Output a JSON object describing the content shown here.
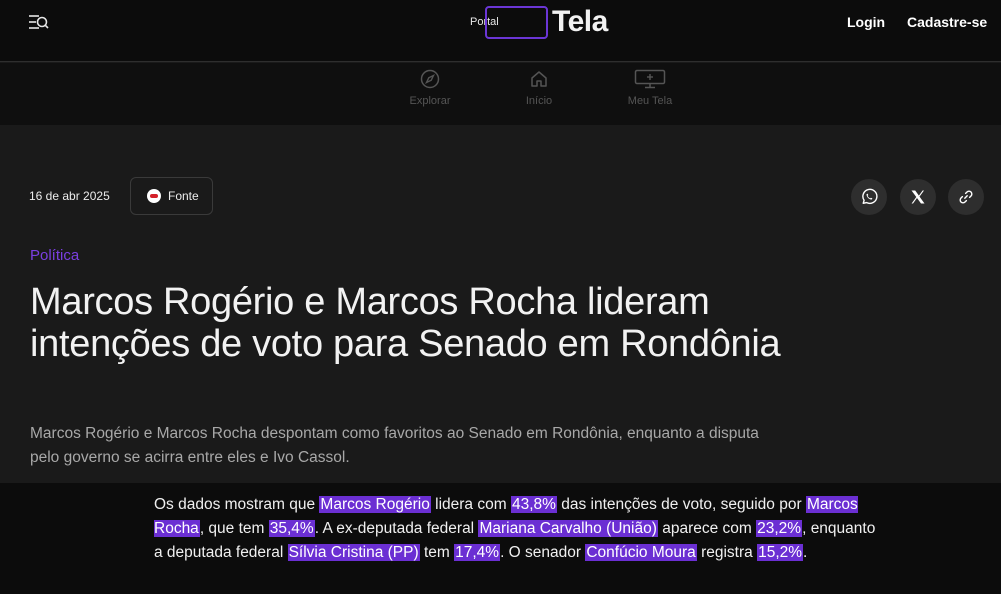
{
  "header": {
    "logo_small": "Portal",
    "logo_main": "Tela",
    "login": "Login",
    "signup": "Cadastre-se"
  },
  "nav": {
    "items": [
      {
        "label": "Explorar",
        "icon": "compass-icon"
      },
      {
        "label": "Início",
        "icon": "home-icon"
      },
      {
        "label": "Meu Tela",
        "icon": "monitor-icon"
      }
    ]
  },
  "article": {
    "date": "16 de abr 2025",
    "source_label": "Fonte",
    "category": "Política",
    "title": "Marcos Rogério e Marcos Rocha lideram intenções de voto para Senado em Rondônia",
    "subtitle": "Marcos Rogério e Marcos Rocha despontam como favoritos ao Senado em Rondônia, enquanto a disputa pelo governo se acirra entre eles e Ivo Cassol.",
    "share": [
      "whatsapp-icon",
      "x-icon",
      "link-icon"
    ],
    "body_segments": [
      {
        "text": "Os dados mostram que ",
        "hl": false
      },
      {
        "text": "Marcos Rogério",
        "hl": true
      },
      {
        "text": " lidera com ",
        "hl": false
      },
      {
        "text": "43,8%",
        "hl": true
      },
      {
        "text": " das intenções de voto, seguido por ",
        "hl": false
      },
      {
        "text": "Marcos Rocha",
        "hl": true
      },
      {
        "text": ", que tem ",
        "hl": false
      },
      {
        "text": "35,4%",
        "hl": true
      },
      {
        "text": ". A ex-deputada federal ",
        "hl": false
      },
      {
        "text": "Mariana Carvalho (União)",
        "hl": true
      },
      {
        "text": " aparece com ",
        "hl": false
      },
      {
        "text": "23,2%",
        "hl": true
      },
      {
        "text": ", enquanto a deputada federal ",
        "hl": false
      },
      {
        "text": "Sílvia Cristina (PP)",
        "hl": true
      },
      {
        "text": " tem ",
        "hl": false
      },
      {
        "text": "17,4%",
        "hl": true
      },
      {
        "text": ". O senador ",
        "hl": false
      },
      {
        "text": "Confúcio Moura",
        "hl": true
      },
      {
        "text": " registra ",
        "hl": false
      },
      {
        "text": "15,2%",
        "hl": true
      },
      {
        "text": ".",
        "hl": false
      }
    ]
  },
  "colors": {
    "accent": "#6b2fd3",
    "category": "#7a3fe0",
    "background": "#1a1a1a"
  }
}
